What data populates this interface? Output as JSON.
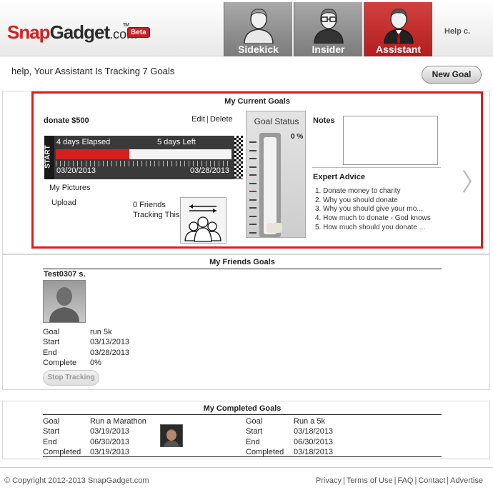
{
  "header": {
    "logo_snap": "Snap",
    "logo_gadget": "Gadget",
    "logo_dotcom": ".com",
    "logo_tm": "TM",
    "beta": "Beta",
    "tabs": [
      {
        "label": "Sidekick",
        "icon": "person-icon",
        "active": false
      },
      {
        "label": "Insider",
        "icon": "person-glasses-icon",
        "active": false
      },
      {
        "label": "Assistant",
        "icon": "person-suit-icon",
        "active": true
      }
    ],
    "help_label": "Help c."
  },
  "subheader": {
    "tracking_text": "help, Your Assistant Is Tracking 7 Goals",
    "new_goal_label": "New Goal"
  },
  "current_goals": {
    "title": "My Current Goals",
    "goal_name": "donate $500",
    "edit_label": "Edit",
    "delete_label": "Delete",
    "elapsed_text": "4 days Elapsed",
    "left_text": "5 days Left",
    "start_label": "START",
    "start_date": "03/20/2013",
    "end_date": "03/28/2013",
    "progress_fraction": 0.42,
    "my_pictures_label": "My Pictures",
    "upload_label": "Upload",
    "friends_tracking_count": "0 Friends",
    "friends_tracking_suffix": "Tracking This",
    "goal_status_title": "Goal Status",
    "goal_status_percent": "0 %",
    "goal_status_fraction": 0,
    "notes_label": "Notes",
    "expert_advice_title": "Expert Advice",
    "expert_advice": [
      "1.  Donate money to charity",
      "2.  Why you should donate",
      "3.  Why you should give your mo...",
      "4.  How much to donate - God knows",
      "5.  How much should you donate ..."
    ],
    "accent_color": "#e01b1b"
  },
  "friends_goals": {
    "title": "My Friends Goals",
    "friend_name": "Test0307 s.",
    "goal_label": "Goal",
    "goal_value": "run 5k",
    "start_label": "Start",
    "start_value": "03/13/2013",
    "end_label": "End",
    "end_value": "03/28/2013",
    "complete_label": "Complete",
    "complete_value": "0%",
    "stop_tracking_label": "Stop Tracking"
  },
  "completed_goals": {
    "title": "My Completed Goals",
    "items": [
      {
        "goal_label": "Goal",
        "goal_value": "Run a Marathon",
        "start_label": "Start",
        "start_value": "03/19/2013",
        "end_label": "End",
        "end_value": "06/30/2013",
        "completed_label": "Completed",
        "completed_value": "03/19/2013"
      },
      {
        "goal_label": "Goal",
        "goal_value": "Run a 5k",
        "start_label": "Start",
        "start_value": "03/18/2013",
        "end_label": "End",
        "end_value": "06/30/2013",
        "completed_label": "Completed",
        "completed_value": "03/18/2013"
      }
    ]
  },
  "footer": {
    "copyright": "© Copyright 2012-2013 SnapGadget.com",
    "links": [
      "Privacy",
      "Terms of Use",
      "FAQ",
      "Contact",
      "Advertise"
    ]
  }
}
